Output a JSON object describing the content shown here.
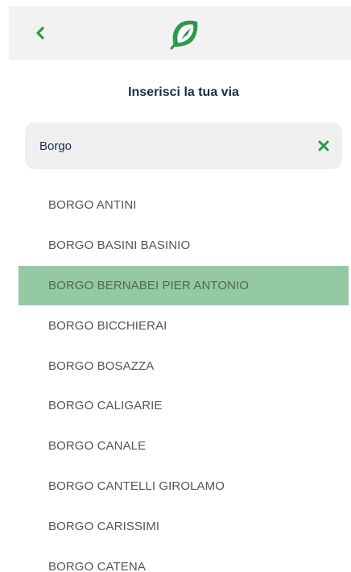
{
  "colors": {
    "accent_green": "#2b9a4a",
    "selected_row": "#94c9a2",
    "title_navy": "#1d2a4f",
    "header_bg": "#f2f2f2"
  },
  "header": {
    "back_icon": "chevron-left-icon",
    "logo_icon": "leaf-compass-logo"
  },
  "page": {
    "title": "Inserisci la tua via"
  },
  "search": {
    "value": "Borgo",
    "clear_icon": "close-icon"
  },
  "streets": {
    "selected_index": 2,
    "items": [
      "BORGO ANTINI",
      "BORGO BASINI BASINIO",
      "BORGO BERNABEI PIER ANTONIO",
      "BORGO BICCHIERAI",
      "BORGO BOSAZZA",
      "BORGO CALIGARIE",
      "BORGO CANALE",
      "BORGO CANTELLI GIROLAMO",
      "BORGO CARISSIMI",
      "BORGO CATENA"
    ]
  }
}
